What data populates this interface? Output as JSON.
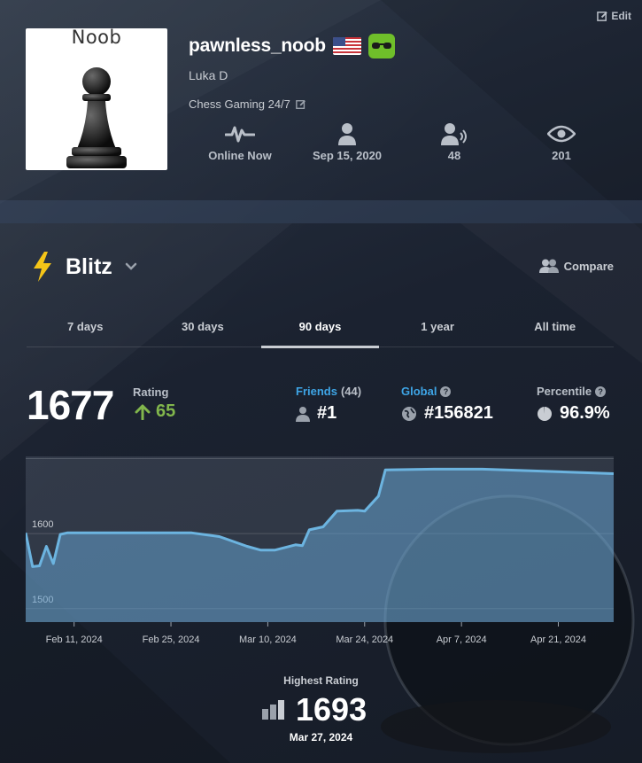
{
  "header": {
    "edit_label": "Edit",
    "avatar_caption": "Noob",
    "username": "pawnless_noob",
    "real_name": "Luka D",
    "status": "Chess Gaming 24/7",
    "stats": [
      {
        "icon": "pulse-icon",
        "value": "Online Now"
      },
      {
        "icon": "person-icon",
        "value": "Sep 15, 2020"
      },
      {
        "icon": "friends-icon",
        "value": "48"
      },
      {
        "icon": "eye-icon",
        "value": "201"
      }
    ]
  },
  "section": {
    "title": "Blitz",
    "compare_label": "Compare",
    "tabs": [
      {
        "label": "7 days",
        "active": false
      },
      {
        "label": "30 days",
        "active": false
      },
      {
        "label": "90 days",
        "active": true
      },
      {
        "label": "1 year",
        "active": false
      },
      {
        "label": "All time",
        "active": false
      }
    ]
  },
  "rating": {
    "value": "1677",
    "label": "Rating",
    "change": "65"
  },
  "metrics": {
    "friends_label": "Friends",
    "friends_count": "(44)",
    "friends_rank": "#1",
    "global_label": "Global",
    "global_rank": "#156821",
    "percentile_label": "Percentile",
    "percentile_value": "96.9%"
  },
  "highest": {
    "label": "Highest Rating",
    "value": "1693",
    "date": "Mar 27, 2024"
  },
  "colors": {
    "accent_green": "#81b64c",
    "link_blue": "#3ea5e6",
    "line": "#6cb4e0",
    "bolt": "#f5c518"
  },
  "chart_data": {
    "type": "area",
    "x_ticks": [
      "Feb 11, 2024",
      "Feb 25, 2024",
      "Mar 10, 2024",
      "Mar 24, 2024",
      "Apr 7, 2024",
      "Apr 21, 2024"
    ],
    "y_ticks": [
      1500,
      1600,
      1700
    ],
    "ylim": [
      1482,
      1703
    ],
    "xlim": [
      "2024-02-04",
      "2024-04-29"
    ],
    "grid": true,
    "series": [
      {
        "x": [
          "2024-02-04",
          "2024-02-05",
          "2024-02-06",
          "2024-02-07",
          "2024-02-08",
          "2024-02-09",
          "2024-02-10",
          "2024-02-12",
          "2024-02-20",
          "2024-02-28",
          "2024-03-03",
          "2024-03-07",
          "2024-03-09",
          "2024-03-11",
          "2024-03-14",
          "2024-03-15",
          "2024-03-16",
          "2024-03-18",
          "2024-03-20",
          "2024-03-23",
          "2024-03-24",
          "2024-03-26",
          "2024-03-27",
          "2024-04-03",
          "2024-04-10",
          "2024-04-29"
        ],
        "values": [
          1601,
          1556,
          1557,
          1583,
          1560,
          1599,
          1601,
          1601,
          1601,
          1601,
          1596,
          1583,
          1578,
          1578,
          1585,
          1584,
          1605,
          1609,
          1630,
          1631,
          1630,
          1650,
          1685,
          1686,
          1686,
          1680
        ]
      }
    ]
  }
}
